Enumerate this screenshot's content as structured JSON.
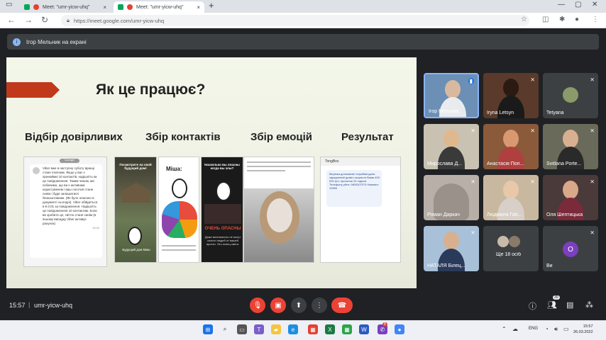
{
  "browser": {
    "tabs": [
      {
        "label": "Meet: \"umr-yicw-uhq\"",
        "close": "×"
      },
      {
        "label": "Meet: \"umr-yicw-uhq\"",
        "close": "×"
      }
    ],
    "new_tab": "+",
    "url": "https://meet.google.com/umr-yicw-uhq",
    "window_controls": {
      "minimize": "—",
      "maximize": "▢",
      "close": "✕"
    }
  },
  "meet": {
    "presenter_banner": "Ігор Мельник на екрані",
    "time": "15:57",
    "separator": "|",
    "code": "umr-yicw-uhq",
    "people_badge": "30",
    "participants": [
      {
        "name": "Ігор Мельник"
      },
      {
        "name": "Iryna Letsyn"
      },
      {
        "name": "Tetyana"
      },
      {
        "name": "Мирослава Д..."
      },
      {
        "name": "Анастасія Поп..."
      },
      {
        "name": "Svitlana Porte..."
      },
      {
        "name": "Роман Даркач"
      },
      {
        "name": "Людмила Габ..."
      },
      {
        "name": "Оля Шептицька"
      },
      {
        "name": "НАТАЛЯ Білец..."
      },
      {
        "name": "Ще 18 осіб"
      },
      {
        "name": "Ви",
        "initial": "О"
      }
    ]
  },
  "slide": {
    "title": "Як це працює?",
    "columns": [
      "Відбір довірливих",
      "Збір контактів",
      "Збір емоцій",
      "Результат"
    ],
    "viber_tag": "Сьогодні",
    "viber_text": "Viber вже в наступну суботу вранці стане платним. Якщо у вас є принаймні 10 контактів, надішліть їм це повідомлення. Таким чином, ми побачимо, що ви є активним користувачем і ваш логотип стане синім і буде залишатися безкоштовним. (Як було описано в документі сьогодні). Viber обійдеться в € 0.01 за повідомлення. Надішліть це повідомлення 10 контактам. Коли ви зробите це, світло стане синім (в іншому випадку Viber активує рахунок)",
    "viber_time": "13:43",
    "meme1_text": "Посмотрите на свой будущий дом!",
    "meme1_bottom": "Будущий дом Миш",
    "meme2_text": "Міша:",
    "meme3_text": "Насколько вы опасны когда вы злы?",
    "meme3_mid": "ОЧЕНЬ ОПАСНЫ",
    "meme3_bottom": "Даже менталисты не могут спасти людей от вашей ярости. Это конец света.",
    "sms_header": "TongBox",
    "sms_text": "Мережа допомагає! службам дали зарядчений дозвіл скористи Вами 400 000 грн, протягом 24 години. Телефону уйти: 0800307075 Назвати: 12890",
    "colors": {
      "accent": "#c0391b"
    }
  },
  "taskbar": {
    "lang": "ENG",
    "time": "15:57",
    "date": "26.03.2022",
    "chrome_badge": "8"
  }
}
